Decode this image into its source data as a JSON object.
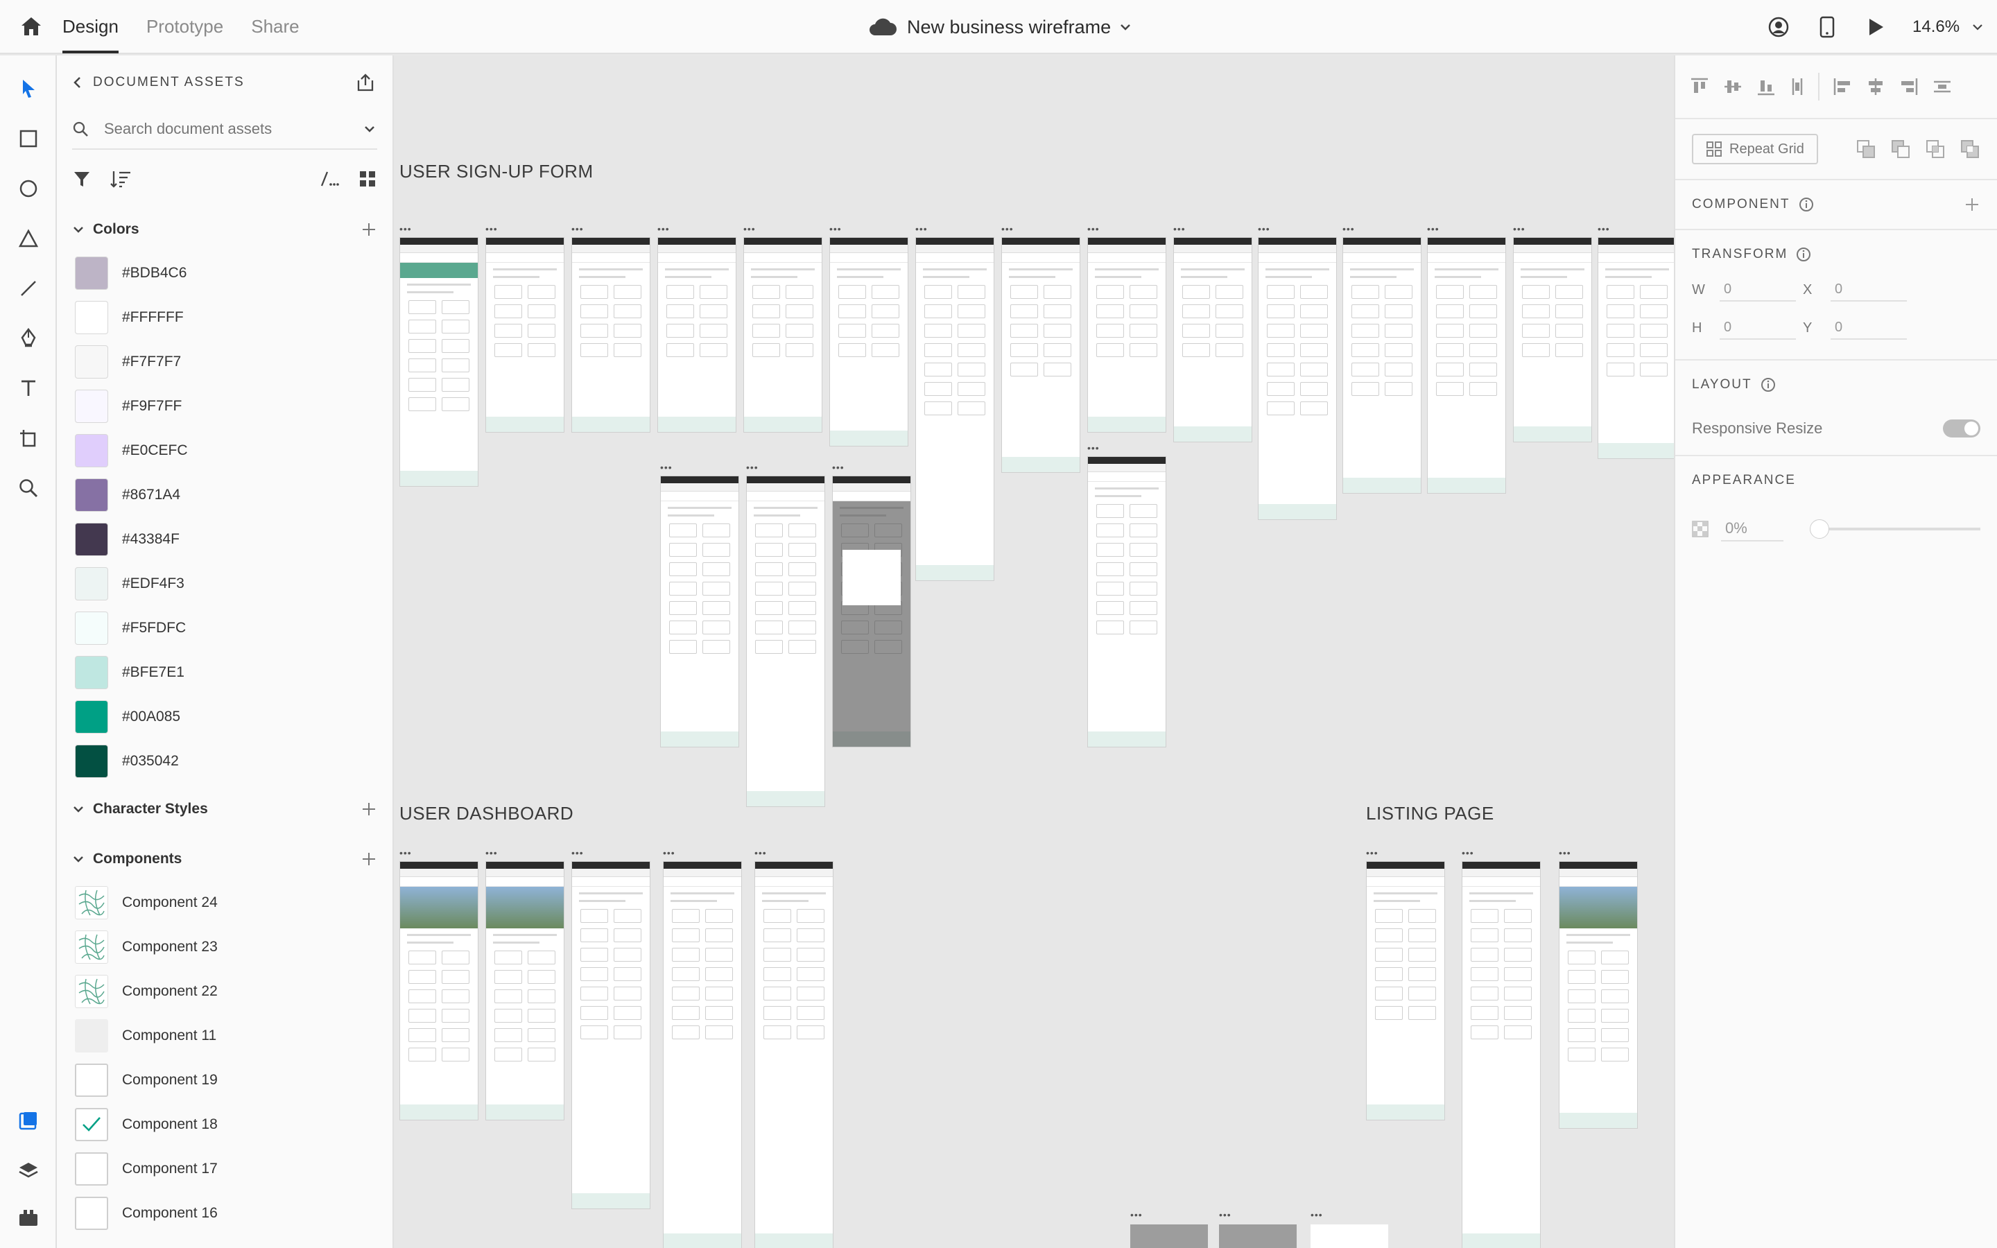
{
  "topbar": {
    "tabs": [
      {
        "label": "Design",
        "active": true
      },
      {
        "label": "Prototype",
        "active": false
      },
      {
        "label": "Share",
        "active": false
      }
    ],
    "document_title": "New business wireframe",
    "zoom": "14.6%"
  },
  "assets": {
    "header": "DOCUMENT ASSETS",
    "search_placeholder": "Search document assets",
    "colors_title": "Colors",
    "colors": [
      {
        "hex": "#BDB4C6"
      },
      {
        "hex": "#FFFFFF"
      },
      {
        "hex": "#F7F7F7"
      },
      {
        "hex": "#F9F7FF"
      },
      {
        "hex": "#E0CEFC"
      },
      {
        "hex": "#8671A4"
      },
      {
        "hex": "#43384F"
      },
      {
        "hex": "#EDF4F3"
      },
      {
        "hex": "#F5FDFC"
      },
      {
        "hex": "#BFE7E1"
      },
      {
        "hex": "#00A085"
      },
      {
        "hex": "#035042"
      }
    ],
    "char_styles_title": "Character Styles",
    "components_title": "Components",
    "components": [
      {
        "name": "Component 24",
        "icon": "map-pattern"
      },
      {
        "name": "Component 23",
        "icon": "map-pattern"
      },
      {
        "name": "Component 22",
        "icon": "map-pattern"
      },
      {
        "name": "Component 11",
        "icon": "blank"
      },
      {
        "name": "Component 19",
        "icon": "checkbox-empty"
      },
      {
        "name": "Component 18",
        "icon": "checkbox-checked"
      },
      {
        "name": "Component 17",
        "icon": "checkbox-empty"
      },
      {
        "name": "Component 16",
        "icon": "checkbox-empty"
      }
    ]
  },
  "canvas": {
    "sections": [
      {
        "label": "USER SIGN-UP FORM"
      },
      {
        "label": "USER DASHBOARD"
      },
      {
        "label": "LISTING PAGE"
      }
    ]
  },
  "props": {
    "repeat_grid": "Repeat Grid",
    "component_title": "COMPONENT",
    "transform_title": "TRANSFORM",
    "w_label": "W",
    "w_value": "0",
    "x_label": "X",
    "x_value": "0",
    "h_label": "H",
    "h_value": "0",
    "y_label": "Y",
    "y_value": "0",
    "layout_title": "LAYOUT",
    "responsive_resize": "Responsive Resize",
    "appearance_title": "APPEARANCE",
    "opacity": "0%"
  },
  "colors": {
    "accent": "#00A085",
    "dark_accent": "#035042",
    "selection_blue": "#1473e6"
  }
}
